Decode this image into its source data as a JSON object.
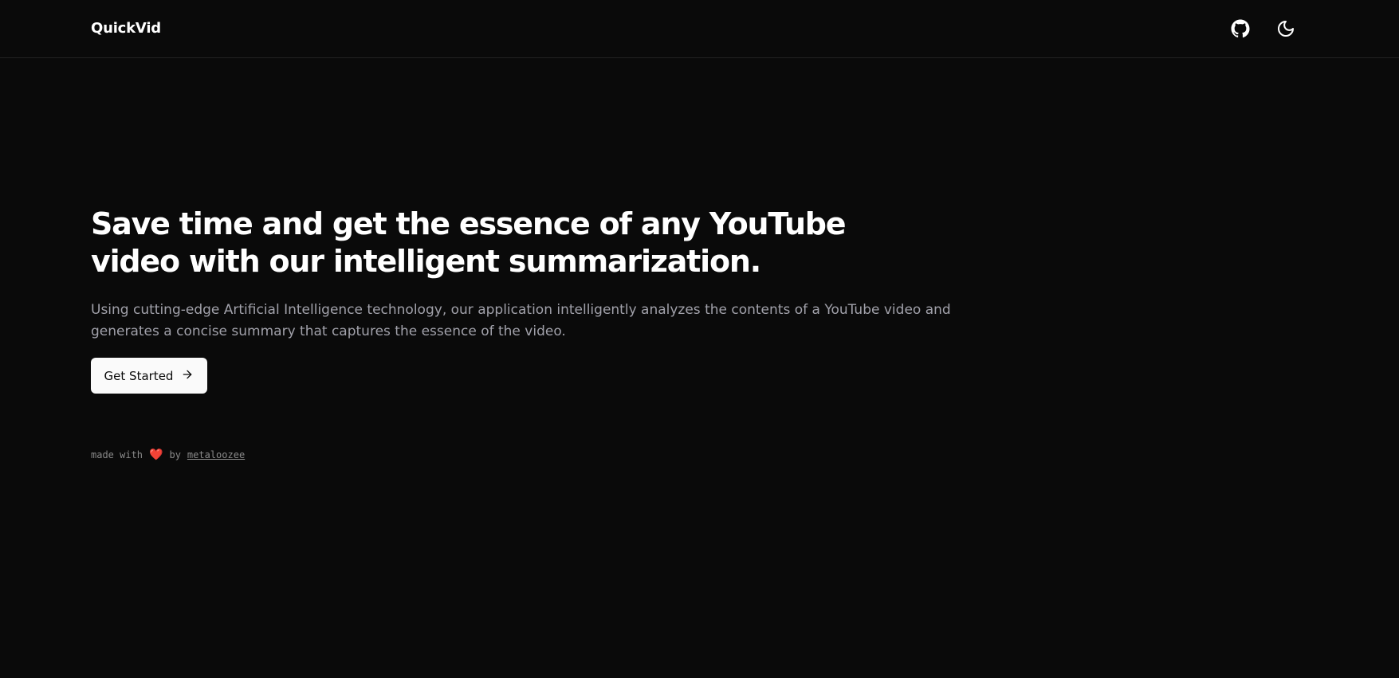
{
  "header": {
    "brand": "QuickVid",
    "icons": {
      "github": "github-icon",
      "theme_toggle": "moon-icon"
    }
  },
  "hero": {
    "headline": "Save time and get the essence of any YouTube video with our intelligent summarization.",
    "subtext": "Using cutting-edge Artificial Intelligence technology, our application intelligently analyzes the contents of a YouTube video and generates a concise summary that captures the essence of the video.",
    "cta_label": "Get Started",
    "cta_icon": "arrow-right-icon"
  },
  "footer": {
    "prefix": "made with",
    "heart": "❤️",
    "by": "by",
    "author": "metaloozee"
  },
  "colors": {
    "background": "#0a0a0a",
    "text": "#fafafa",
    "muted": "#a1a1aa",
    "heart": "#ef4444",
    "border": "#222222"
  }
}
